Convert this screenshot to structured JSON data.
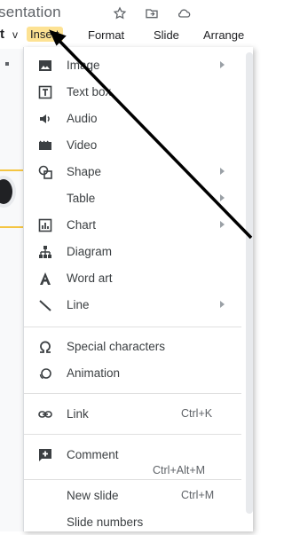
{
  "title_bar": {
    "title": "sentation",
    "star_icon": "star-outline-icon",
    "folder_icon": "move-to-folder-icon",
    "cloud_icon": "cloud-status-icon"
  },
  "menubar": {
    "left_fragment": "t",
    "left_fragment2": "v",
    "items": [
      "Insert",
      "Format",
      "Slide",
      "Arrange"
    ]
  },
  "insert_menu": {
    "items": [
      {
        "label": "Image",
        "icon": "image-icon",
        "submenu": true
      },
      {
        "label": "Text box",
        "icon": "text-box-icon",
        "submenu": false
      },
      {
        "label": "Audio",
        "icon": "audio-icon",
        "submenu": false
      },
      {
        "label": "Video",
        "icon": "video-icon",
        "submenu": false
      },
      {
        "label": "Shape",
        "icon": "shape-icon",
        "submenu": true
      },
      {
        "label": "Table",
        "icon": "",
        "submenu": true
      },
      {
        "label": "Chart",
        "icon": "chart-icon",
        "submenu": true
      },
      {
        "label": "Diagram",
        "icon": "diagram-icon",
        "submenu": false
      },
      {
        "label": "Word art",
        "icon": "word-art-icon",
        "submenu": false
      },
      {
        "label": "Line",
        "icon": "line-icon",
        "submenu": true
      },
      {
        "label": "Special characters",
        "icon": "omega-icon",
        "submenu": false
      },
      {
        "label": "Animation",
        "icon": "animation-icon",
        "submenu": false
      },
      {
        "label": "Link",
        "icon": "link-icon",
        "submenu": false,
        "shortcut": "Ctrl+K"
      },
      {
        "label": "Comment",
        "icon": "comment-add-icon",
        "submenu": false,
        "shortcut": "Ctrl+Alt+M"
      },
      {
        "label": "New slide",
        "icon": "",
        "submenu": false,
        "shortcut": "Ctrl+M"
      },
      {
        "label": "Slide numbers",
        "icon": "",
        "submenu": false
      }
    ]
  },
  "colors": {
    "insert_highlight": "#fde293",
    "annotation_arrow": "#000000"
  }
}
